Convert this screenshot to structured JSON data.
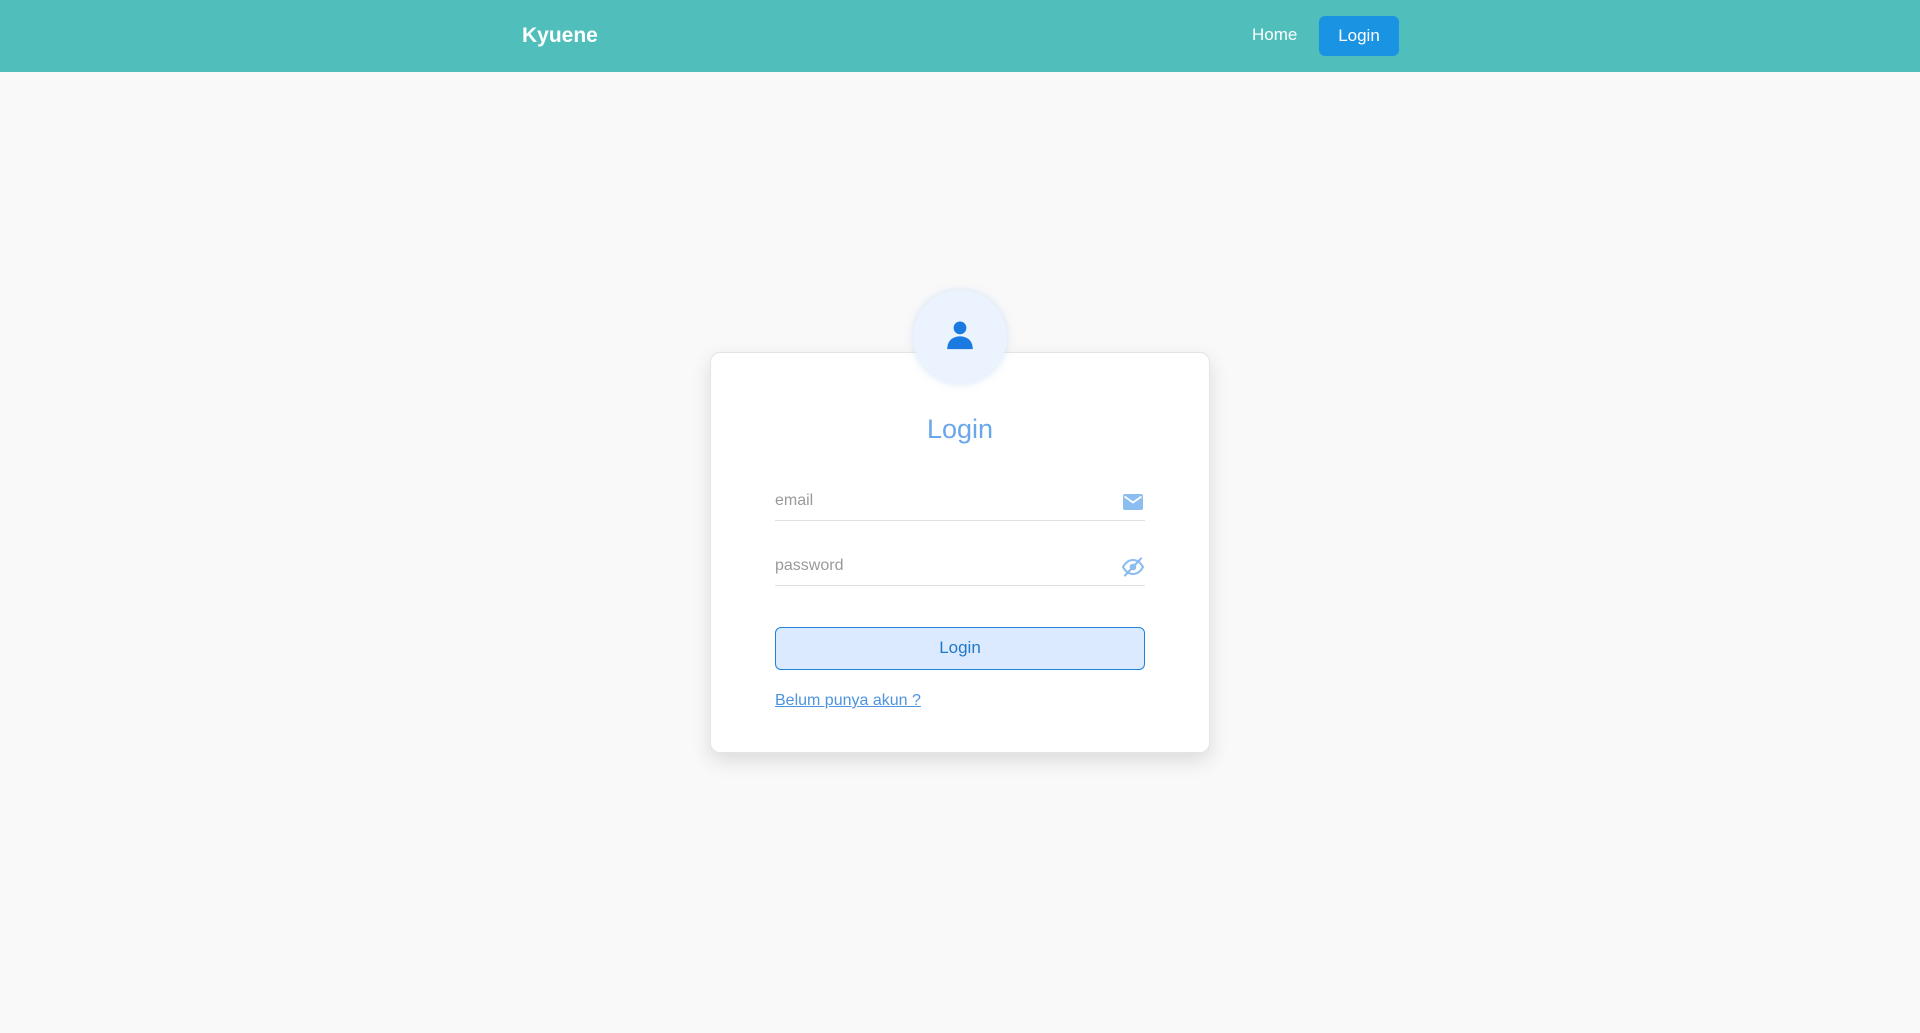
{
  "navbar": {
    "brand": "Kyuene",
    "home_label": "Home",
    "login_label": "Login"
  },
  "login_card": {
    "avatar_icon": "user-icon",
    "title": "Login",
    "email": {
      "placeholder": "email",
      "value": "",
      "icon": "envelope-icon"
    },
    "password": {
      "placeholder": "password",
      "value": "",
      "icon": "eye-slash-icon"
    },
    "submit_label": "Login",
    "register_link": "Belum punya akun ?"
  },
  "colors": {
    "navbar_bg": "#50bfbc",
    "nav_login_bg": "#1a93e3",
    "accent": "#1f82dc",
    "title": "#6aa7ea"
  }
}
